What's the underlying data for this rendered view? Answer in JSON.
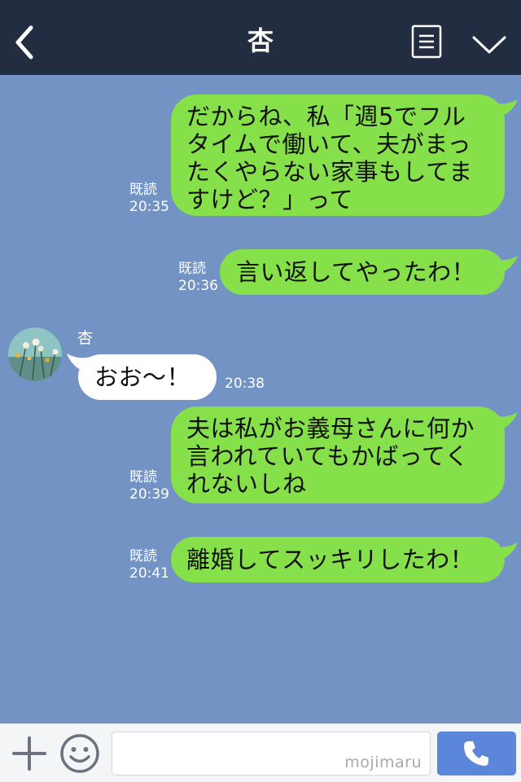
{
  "header": {
    "title": "杏"
  },
  "messages": [
    {
      "direction": "out",
      "lines": [
        "だからね、私「週5でフル",
        "タイムで働いて、夫がまっ",
        "たくやらない家事もしてま",
        "すけど？」って"
      ],
      "read_label": "既読",
      "time": "20:35"
    },
    {
      "direction": "out",
      "lines": [
        "言い返してやったわ！"
      ],
      "read_label": "既読",
      "time": "20:36"
    },
    {
      "direction": "in",
      "sender": "杏",
      "lines": [
        "おお〜！"
      ],
      "time": "20:38"
    },
    {
      "direction": "out",
      "lines": [
        "夫は私がお義母さんに何か",
        "言われていてもかばってく",
        "れないしね"
      ],
      "read_label": "既読",
      "time": "20:39"
    },
    {
      "direction": "out",
      "lines": [
        "離婚してスッキリしたわ！"
      ],
      "read_label": "既読",
      "time": "20:41"
    }
  ],
  "input": {
    "value": "",
    "watermark": "mojimaru"
  },
  "icons": {
    "back": "chevron-left-icon",
    "notes": "notes-icon",
    "dropdown": "chevron-down-icon",
    "plus": "plus-icon",
    "emoji": "emoji-icon",
    "call": "phone-icon"
  },
  "colors": {
    "header": "#232d42",
    "background": "#7293c4",
    "outgoing_bubble": "#86e04a",
    "incoming_bubble": "#ffffff",
    "call_button": "#5b86d9"
  }
}
